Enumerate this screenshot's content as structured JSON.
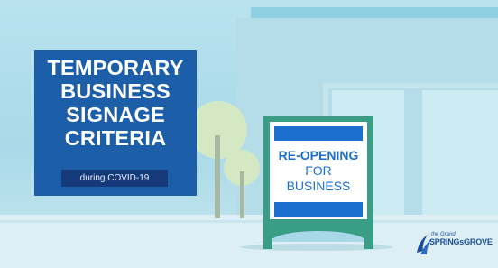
{
  "title": {
    "lines": [
      "TEMPORARY",
      "BUSINESS",
      "SIGNAGE",
      "CRITERIA"
    ],
    "subtitle": "during COVID-19"
  },
  "sign": {
    "line1": "RE-OPENING",
    "line2": "FOR",
    "line3": "BUSINESS"
  },
  "logo": {
    "small": "the Grand",
    "main": "SPRINGsGROVE"
  },
  "colors": {
    "title_box": "#1d5ea8",
    "subtitle_bar": "#16397a",
    "sign_frame": "#3a9d86",
    "sign_accent": "#1d6fcd",
    "sky": "#a9d9e8"
  }
}
